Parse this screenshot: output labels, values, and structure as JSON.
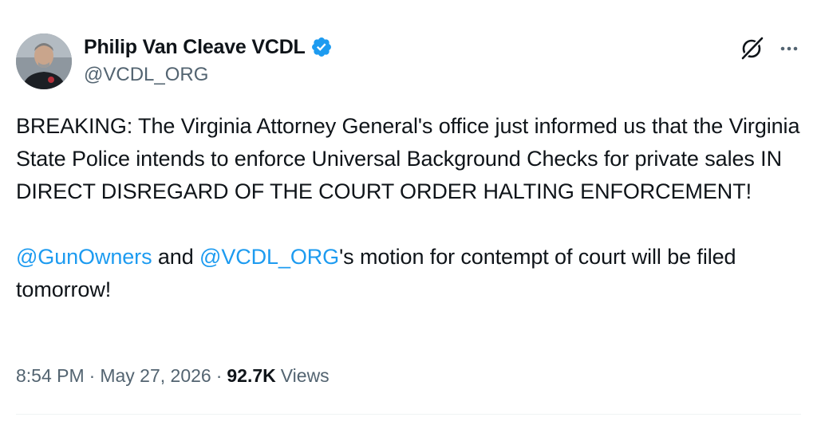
{
  "author": {
    "display_name": "Philip Van Cleave VCDL",
    "handle": "@VCDL_ORG",
    "verified": true
  },
  "tweet": {
    "paragraph1": "BREAKING:  The Virginia Attorney General's office just informed us that the Virginia State Police intends to enforce Universal Background Checks for private sales IN DIRECT DISREGARD OF THE COURT ORDER HALTING ENFORCEMENT!",
    "mention1": "@GunOwners",
    "text_and": " and ",
    "mention2": "@VCDL_ORG",
    "text_rest": "'s motion for contempt of court will be filed tomorrow!"
  },
  "meta": {
    "time": "8:54 PM",
    "separator": "·",
    "date": "May 27, 2026",
    "views_count": "92.7K",
    "views_label": "Views"
  },
  "icons": {
    "verified": "verified-badge-icon",
    "grok": "grok-icon",
    "more": "more-options-icon"
  },
  "colors": {
    "link": "#1d9bf0",
    "secondary_text": "#536471",
    "primary_text": "#0f1419",
    "verified_badge": "#1d9bf0"
  }
}
